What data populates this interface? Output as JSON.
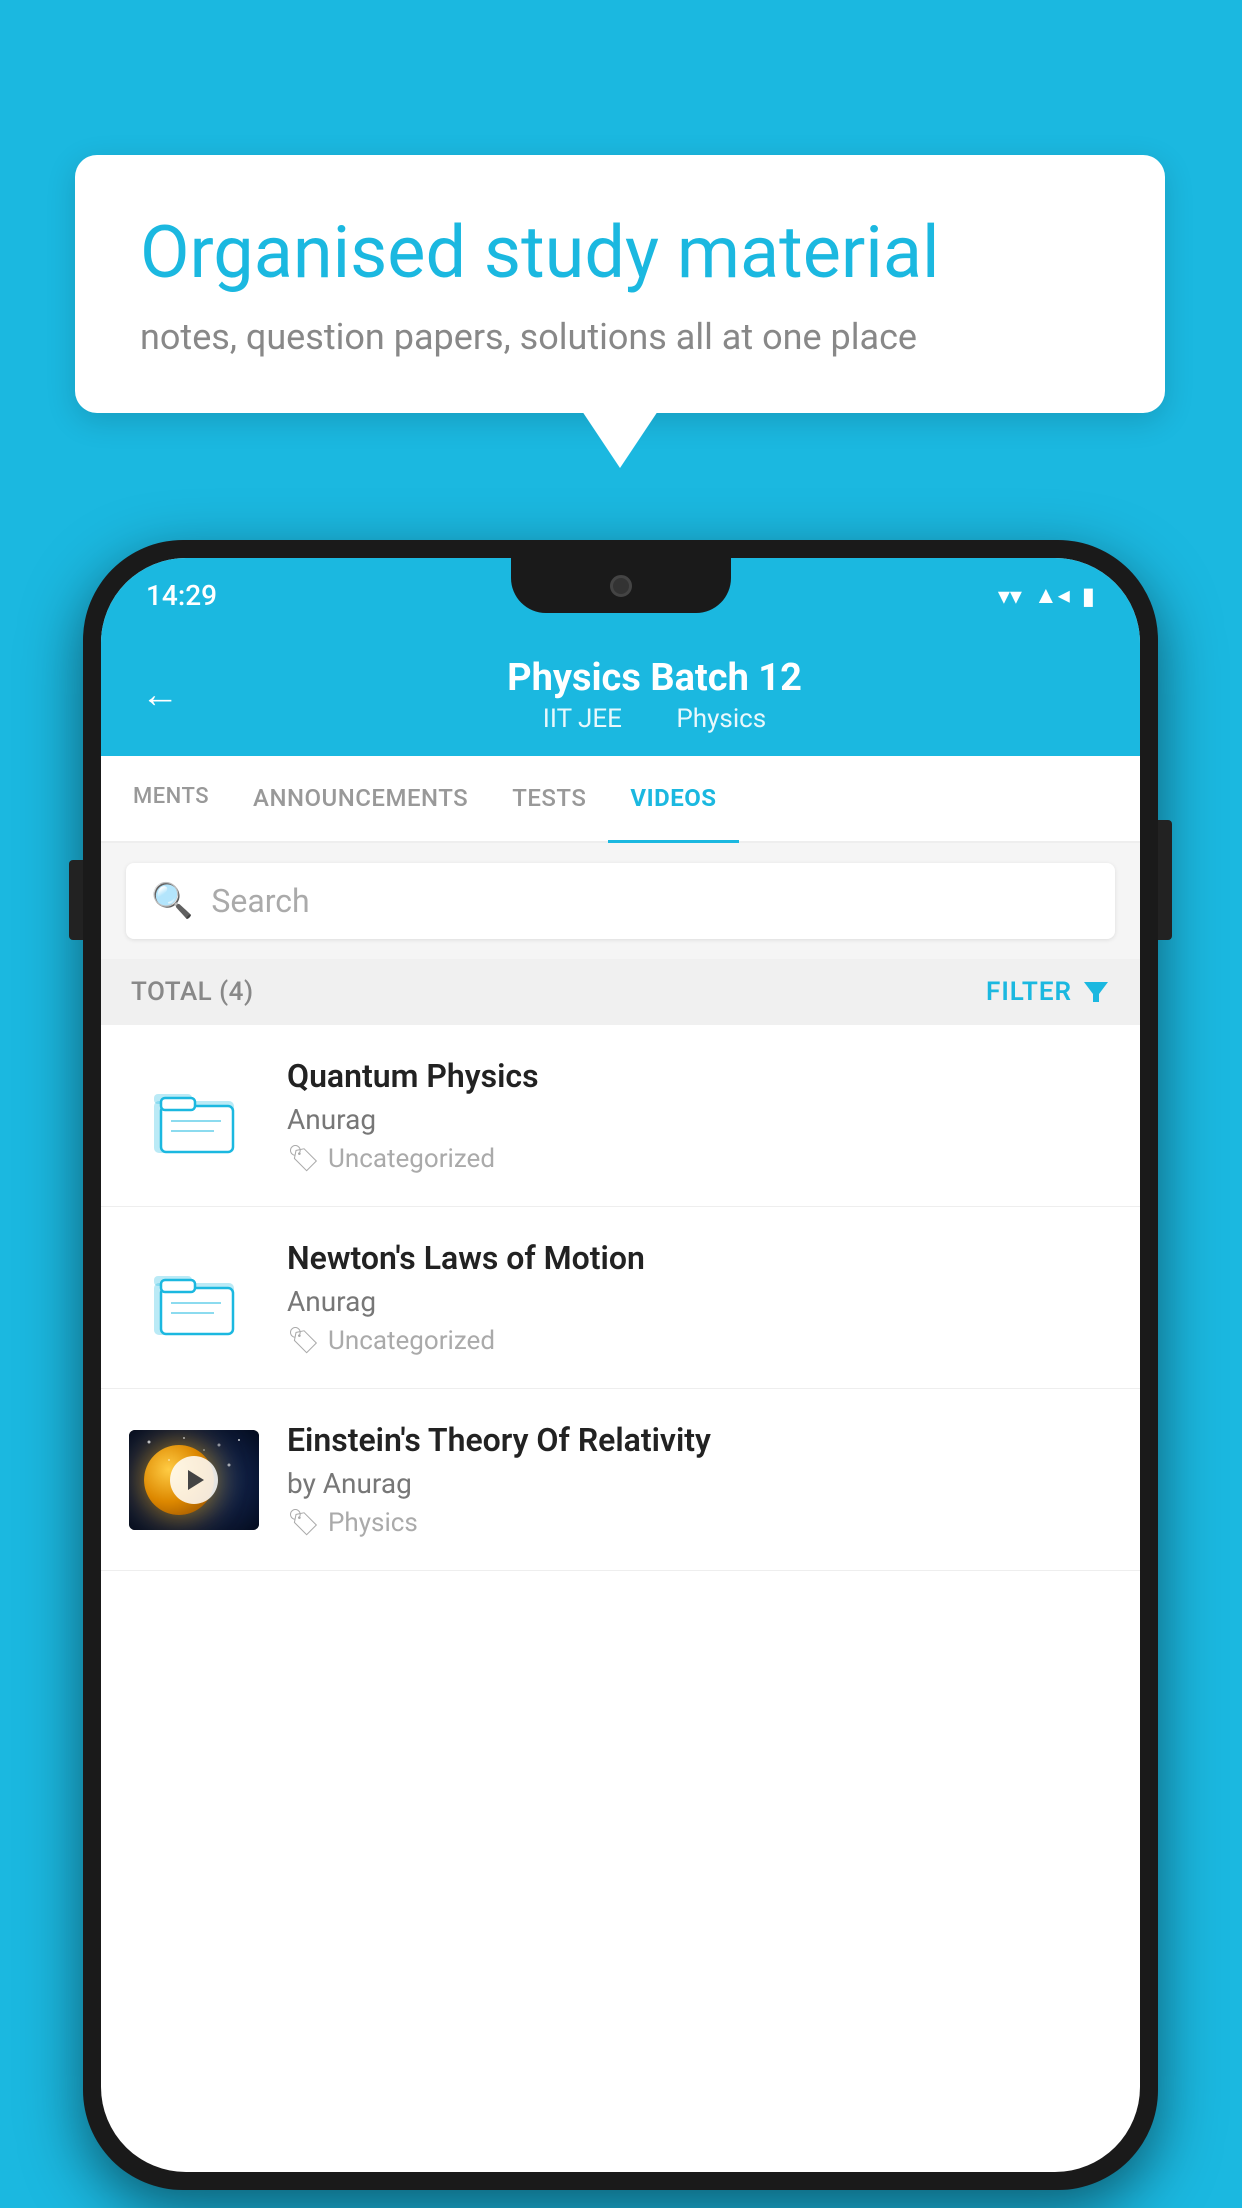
{
  "background_color": "#1BB8E0",
  "bubble": {
    "title": "Organised study material",
    "subtitle": "notes, question papers, solutions all at one place"
  },
  "phone": {
    "status_bar": {
      "time": "14:29"
    },
    "header": {
      "title": "Physics Batch 12",
      "subtitle1": "IIT JEE",
      "subtitle2": "Physics",
      "back_label": "←"
    },
    "tabs": [
      {
        "label": "MENTS",
        "active": false
      },
      {
        "label": "ANNOUNCEMENTS",
        "active": false
      },
      {
        "label": "TESTS",
        "active": false
      },
      {
        "label": "VIDEOS",
        "active": true
      }
    ],
    "search": {
      "placeholder": "Search"
    },
    "filter_bar": {
      "total_label": "TOTAL (4)",
      "filter_label": "FILTER"
    },
    "videos": [
      {
        "title": "Quantum Physics",
        "author": "Anurag",
        "tag": "Uncategorized",
        "type": "folder"
      },
      {
        "title": "Newton's Laws of Motion",
        "author": "Anurag",
        "tag": "Uncategorized",
        "type": "folder"
      },
      {
        "title": "Einstein's Theory Of Relativity",
        "author": "by Anurag",
        "tag": "Physics",
        "type": "video"
      }
    ]
  }
}
